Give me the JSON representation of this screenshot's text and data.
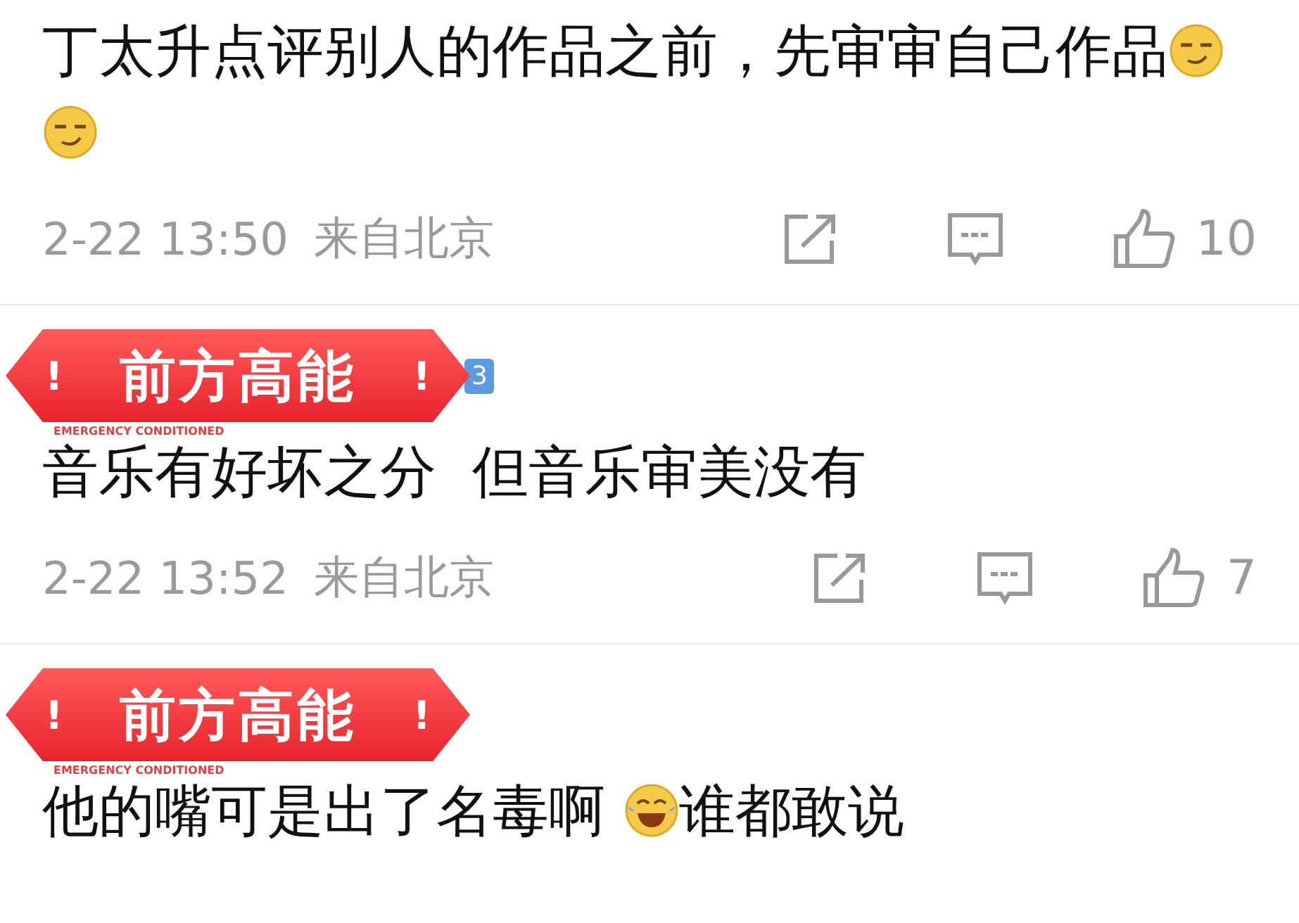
{
  "comments": [
    {
      "segments": [
        {
          "kind": "text",
          "text": "丁太升点评别人的作品之前，先审审自己作品"
        },
        {
          "kind": "emoji"
        },
        {
          "kind": "emoji"
        }
      ],
      "time": "2-22 13:50",
      "location": "来自北京",
      "likes": "10"
    },
    {
      "sticker": {
        "left_mark": "!",
        "title": "前方高能",
        "right_mark": "!",
        "caption": "EMERGENCY CONDITIONED"
      },
      "level_badge": "3",
      "segments": [
        {
          "kind": "text",
          "text": "音乐有好坏之分  但音乐审美没有"
        }
      ],
      "time": "2-22 13:52",
      "location": "来自北京",
      "likes": "7"
    },
    {
      "sticker": {
        "left_mark": "!",
        "title": "前方高能",
        "right_mark": "!",
        "caption": "EMERGENCY CONDITIONED"
      },
      "segments": [
        {
          "kind": "text",
          "text": "他的嘴可是出了名毒啊 "
        },
        {
          "kind": "laugh"
        },
        {
          "kind": "text",
          "text": "谁都敢说"
        }
      ]
    }
  ]
}
